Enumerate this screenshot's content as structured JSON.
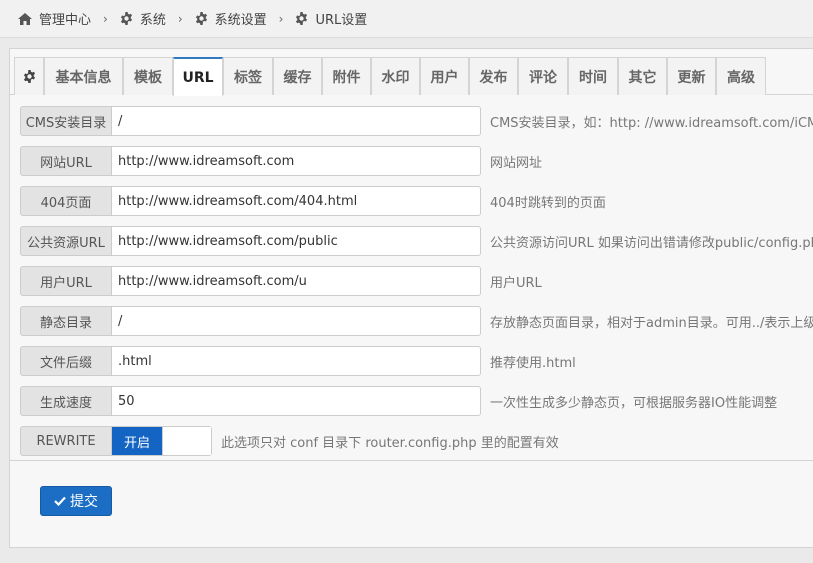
{
  "breadcrumb": {
    "items": [
      "管理中心",
      "系统",
      "系统设置",
      "URL设置"
    ],
    "separator": "›"
  },
  "tabs": [
    "基本信息",
    "模板",
    "URL",
    "标签",
    "缓存",
    "附件",
    "水印",
    "用户",
    "发布",
    "评论",
    "时间",
    "其它",
    "更新",
    "高级"
  ],
  "active_tab": "URL",
  "form": {
    "rows": [
      {
        "label": "CMS安装目录",
        "value": "/",
        "help": "CMS安装目录，如：http: //www.idreamsoft.com/iCMS"
      },
      {
        "label": "网站URL",
        "value": "http://www.idreamsoft.com",
        "help": "网站网址"
      },
      {
        "label": "404页面",
        "value": "http://www.idreamsoft.com/404.html",
        "help": "404时跳转到的页面"
      },
      {
        "label": "公共资源URL",
        "value": "http://www.idreamsoft.com/public",
        "help": "公共资源访问URL 如果访问出错请修改public/config.php"
      },
      {
        "label": "用户URL",
        "value": "http://www.idreamsoft.com/u",
        "help": "用户URL"
      },
      {
        "label": "静态目录",
        "value": "/",
        "help": "存放静态页面目录，相对于admin目录。可用../表示上级目录"
      },
      {
        "label": "文件后缀",
        "value": ".html",
        "help": "推荐使用.html"
      },
      {
        "label": "生成速度",
        "value": "50",
        "help": "一次性生成多少静态页，可根据服务器IO性能调整"
      }
    ],
    "rewrite": {
      "label": "REWRITE",
      "state": "开启",
      "help": "此选项只对 conf 目录下 router.config.php 里的配置有效"
    }
  },
  "submit_label": "提交",
  "colors": {
    "accent": "#1464c4",
    "tab_active_border": "#2f7bc4"
  }
}
